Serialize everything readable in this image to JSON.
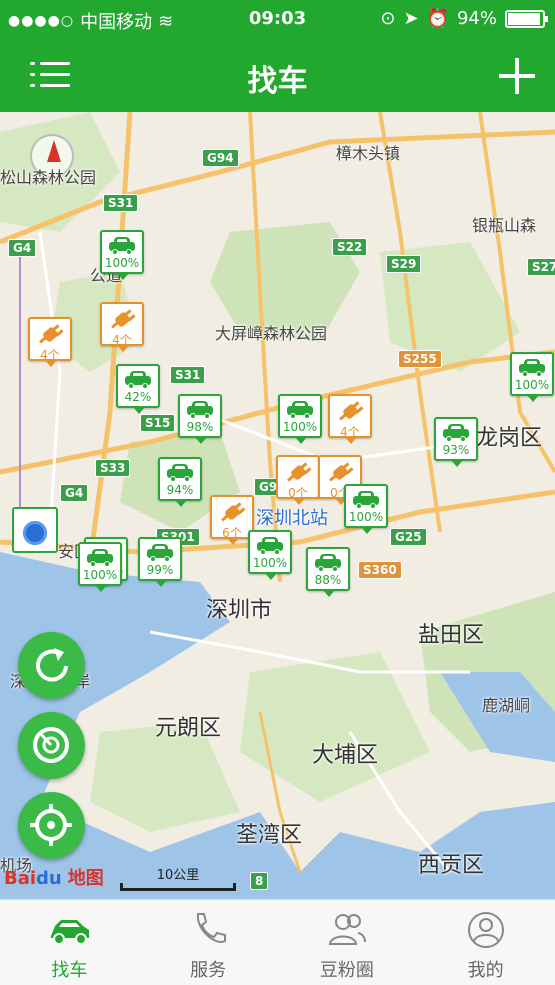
{
  "status_bar": {
    "carrier": "中国移动",
    "time": "09:03",
    "battery": "94%",
    "battery_level": 0.94
  },
  "nav": {
    "title": "找车",
    "menu_icon": "menu-icon",
    "add_icon": "plus-icon"
  },
  "map": {
    "places": {
      "yangmuzhen": "樟木头镇",
      "yinpingshan": "银瓶山森",
      "dapingzhang": "大屏嶂森林公园",
      "longgang": "龙岗区",
      "shenzhen_north": "深圳北站",
      "shenzhen": "深圳市",
      "yantian": "盐田区",
      "luhu": "鹿湖峒",
      "yuanlang": "元朗区",
      "dapu": "大埔区",
      "quanwan": "荃湾区",
      "xigong": "西贡区",
      "forest_park": "松山森林公园",
      "port": "深圳湾口岸",
      "gongdao": "公道",
      "anqu": "安区",
      "jichang": "机场"
    },
    "roads": [
      "G94",
      "S31",
      "G4",
      "S22",
      "S29",
      "S27",
      "S31",
      "S15",
      "S33",
      "G4",
      "G94",
      "S255",
      "S301",
      "G25",
      "S360",
      "8"
    ],
    "markers": [
      {
        "type": "car",
        "value": "100%"
      },
      {
        "type": "charger",
        "value": "4个"
      },
      {
        "type": "charger",
        "value": "4个"
      },
      {
        "type": "car",
        "value": "42%"
      },
      {
        "type": "car",
        "value": "98%"
      },
      {
        "type": "car",
        "value": "100%"
      },
      {
        "type": "charger",
        "value": "4个"
      },
      {
        "type": "car",
        "value": "100%"
      },
      {
        "type": "car",
        "value": "93%"
      },
      {
        "type": "car",
        "value": "94%"
      },
      {
        "type": "charger",
        "value": "0个"
      },
      {
        "type": "charger",
        "value": "0个"
      },
      {
        "type": "car",
        "value": "100%"
      },
      {
        "type": "charger",
        "value": "6个"
      },
      {
        "type": "car",
        "value": "100%"
      },
      {
        "type": "car",
        "value": "100%"
      },
      {
        "type": "car",
        "value": "99%"
      },
      {
        "type": "car",
        "value": "100%"
      },
      {
        "type": "car",
        "value": "88%"
      }
    ],
    "scale_label": "10公里",
    "logo_text_1": "Bai",
    "logo_text_2": "du",
    "logo_text_3": "地图"
  },
  "fabs": [
    "refresh-icon",
    "radar-icon",
    "locate-icon"
  ],
  "tabs": [
    {
      "label": "找车",
      "icon": "car-icon",
      "active": true
    },
    {
      "label": "服务",
      "icon": "phone-icon",
      "active": false
    },
    {
      "label": "豆粉圈",
      "icon": "users-icon",
      "active": false
    },
    {
      "label": "我的",
      "icon": "user-icon",
      "active": false
    }
  ],
  "colors": {
    "brand": "#22a82f",
    "car": "#2aa53a",
    "charger": "#e8902a"
  }
}
